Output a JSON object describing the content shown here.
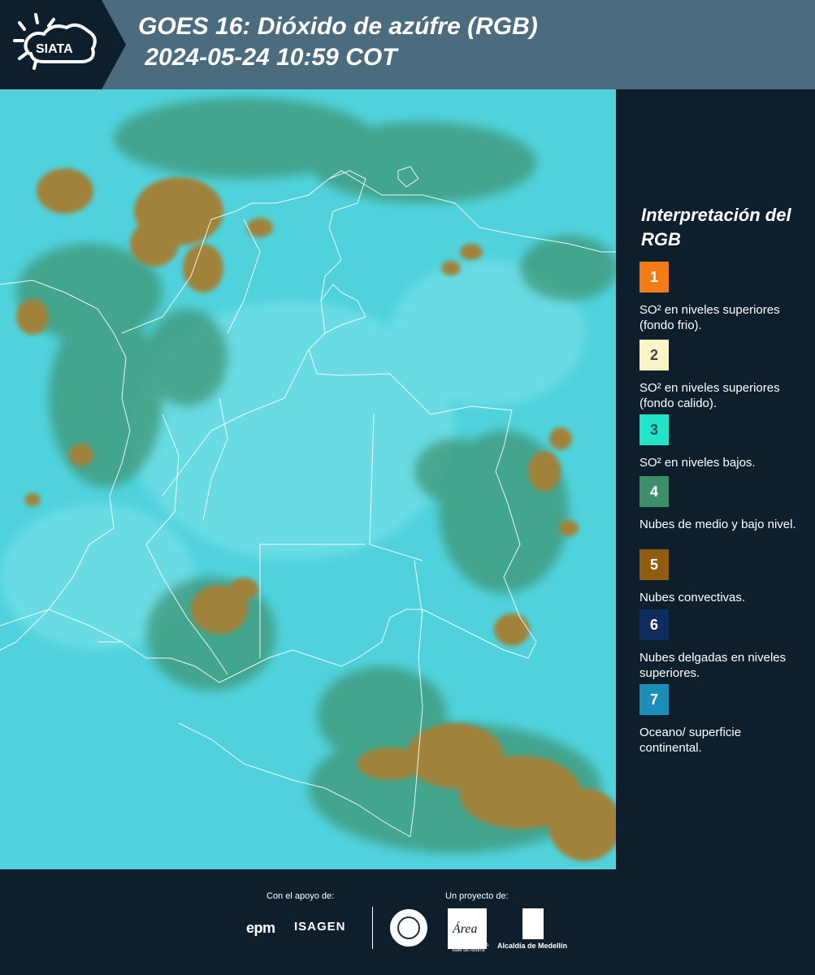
{
  "header": {
    "logo_text": "SIATA",
    "title_line1": "GOES 16: Dióxido de azúfre (RGB)",
    "title_line2": " 2024-05-24 10:59 COT"
  },
  "map": {
    "description_colors": {
      "background": "#4fd2dc",
      "convective": "#9b7a33",
      "midlevel": "#3f8f73",
      "borders": "#ffffff"
    }
  },
  "legend": {
    "title": "Interpretación del RGB",
    "items": [
      {
        "number": "1",
        "color": "#f57c12",
        "num_color": "#ffffff",
        "label": "SO² en niveles superiores (fondo frio)."
      },
      {
        "number": "2",
        "color": "#fbf4c4",
        "num_color": "#444444",
        "label": "SO² en niveles superiores (fondo calido)."
      },
      {
        "number": "3",
        "color": "#21e4c8",
        "num_color": "#1d5a54",
        "label": "SO² en niveles bajos."
      },
      {
        "number": "4",
        "color": "#3d8f6a",
        "num_color": "#ffffff",
        "label": "Nubes de medio y bajo nivel."
      },
      {
        "number": "5",
        "color": "#8f5c10",
        "num_color": "#ffffff",
        "label": "Nubes convectivas."
      },
      {
        "number": "6",
        "color": "#0e2d5e",
        "num_color": "#ffffff",
        "label": "Nubes delgadas en niveles superiores."
      },
      {
        "number": "7",
        "color": "#1b8fb6",
        "num_color": "#ffffff",
        "label": "Oceano/ superficie continental."
      }
    ]
  },
  "footer": {
    "support_label": "Con el apoyo de:",
    "project_label": "Un proyecto de:",
    "sponsor1": "epm",
    "sponsor2": "ISAGEN",
    "area_name": "METROPOLITANA Valle de Aburrá",
    "area_script": "Área",
    "alcaldia": "Alcaldía de Medellín"
  }
}
